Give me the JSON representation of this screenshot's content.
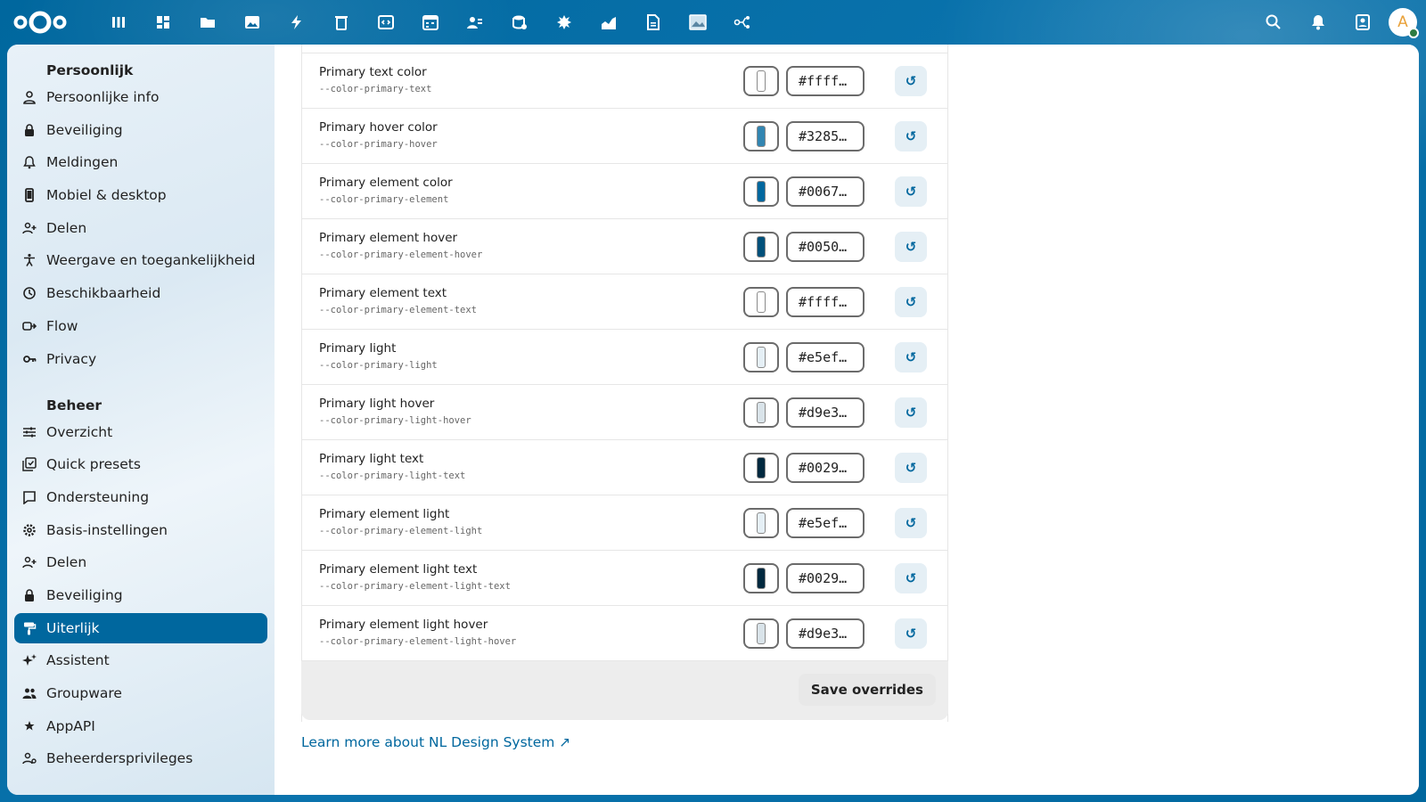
{
  "header": {
    "apps": [
      {
        "icon": "dashboard-icon",
        "name": "app-dashboard"
      },
      {
        "icon": "grid-icon",
        "name": "app-grid"
      },
      {
        "icon": "folder-icon",
        "name": "app-files"
      },
      {
        "icon": "image-icon",
        "name": "app-photos"
      },
      {
        "icon": "bolt-icon",
        "name": "app-activity"
      },
      {
        "icon": "trash-icon",
        "name": "app-deleted"
      },
      {
        "icon": "code-icon",
        "name": "app-code"
      },
      {
        "icon": "calendar-icon",
        "name": "app-calendar"
      },
      {
        "icon": "contacts-icon",
        "name": "app-contacts"
      },
      {
        "icon": "database-icon",
        "name": "app-database"
      },
      {
        "icon": "tools-icon",
        "name": "app-tools"
      },
      {
        "icon": "chart-icon",
        "name": "app-analytics"
      },
      {
        "icon": "document-icon",
        "name": "app-document"
      },
      {
        "icon": "picture-icon",
        "name": "app-picture"
      },
      {
        "icon": "flow-icon",
        "name": "app-flow"
      }
    ],
    "right": [
      "search-icon",
      "bell-icon",
      "contacts-menu-icon"
    ],
    "avatar_letter": "A"
  },
  "sidebar": {
    "personal_caption": "Persoonlijk",
    "personal": [
      {
        "label": "Persoonlijke info",
        "icon": "user-icon"
      },
      {
        "label": "Beveiliging",
        "icon": "lock-icon"
      },
      {
        "label": "Meldingen",
        "icon": "bell-icon"
      },
      {
        "label": "Mobiel & desktop",
        "icon": "phone-icon"
      },
      {
        "label": "Delen",
        "icon": "share-icon"
      },
      {
        "label": "Weergave en toegankelijkheid",
        "icon": "accessibility-icon"
      },
      {
        "label": "Beschikbaarheid",
        "icon": "clock-icon"
      },
      {
        "label": "Flow",
        "icon": "flow-icon"
      },
      {
        "label": "Privacy",
        "icon": "key-icon"
      }
    ],
    "admin_caption": "Beheer",
    "admin": [
      {
        "label": "Overzicht",
        "icon": "sliders-icon"
      },
      {
        "label": "Quick presets",
        "icon": "presets-icon"
      },
      {
        "label": "Ondersteuning",
        "icon": "support-icon"
      },
      {
        "label": "Basis-instellingen",
        "icon": "gear-icon"
      },
      {
        "label": "Delen",
        "icon": "share-icon"
      },
      {
        "label": "Beveiliging",
        "icon": "lock-icon"
      },
      {
        "label": "Uiterlijk",
        "icon": "paint-roller-icon",
        "active": true
      },
      {
        "label": "Assistent",
        "icon": "sparkle-icon"
      },
      {
        "label": "Groupware",
        "icon": "group-icon"
      },
      {
        "label": "AppAPI",
        "icon": "api-icon"
      },
      {
        "label": "Beheerdersprivileges",
        "icon": "admin-user-icon"
      }
    ]
  },
  "rows": [
    {
      "title": "Primary text color",
      "var": "--color-primary-text",
      "hex": "#ffff…",
      "swatch": "#ffffff"
    },
    {
      "title": "Primary hover color",
      "var": "--color-primary-hover",
      "hex": "#3285…",
      "swatch": "#3285b1"
    },
    {
      "title": "Primary element color",
      "var": "--color-primary-element",
      "hex": "#0067…",
      "swatch": "#00679e"
    },
    {
      "title": "Primary element hover",
      "var": "--color-primary-element-hover",
      "hex": "#0050…",
      "swatch": "#00507a"
    },
    {
      "title": "Primary element text",
      "var": "--color-primary-element-text",
      "hex": "#ffff…",
      "swatch": "#ffffff"
    },
    {
      "title": "Primary light",
      "var": "--color-primary-light",
      "hex": "#e5ef…",
      "swatch": "#e5eff5"
    },
    {
      "title": "Primary light hover",
      "var": "--color-primary-light-hover",
      "hex": "#d9e3…",
      "swatch": "#d9e3e9"
    },
    {
      "title": "Primary light text",
      "var": "--color-primary-light-text",
      "hex": "#0029…",
      "swatch": "#00293f"
    },
    {
      "title": "Primary element light",
      "var": "--color-primary-element-light",
      "hex": "#e5ef…",
      "swatch": "#e5eff5"
    },
    {
      "title": "Primary element light text",
      "var": "--color-primary-element-light-text",
      "hex": "#0029…",
      "swatch": "#00293f"
    },
    {
      "title": "Primary element light hover",
      "var": "--color-primary-element-light-hover",
      "hex": "#d9e3…",
      "swatch": "#d9e3e9"
    }
  ],
  "reset_glyph": "↺",
  "save_label": "Save overrides",
  "learn_more": "Learn more about NL Design System ↗",
  "colors": {
    "brand": "#00679e",
    "active_nav": "#00679e"
  }
}
